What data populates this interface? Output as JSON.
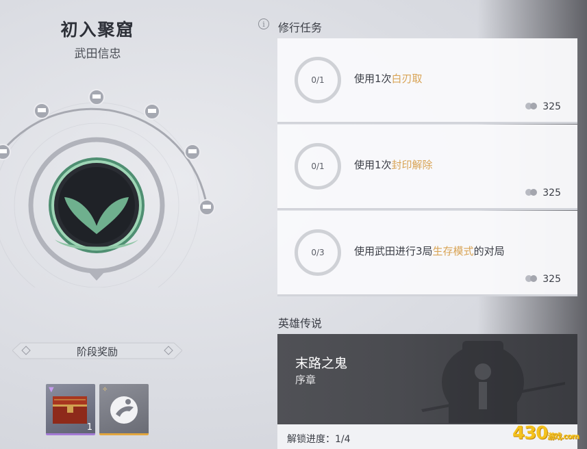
{
  "rank": {
    "title": "初入聚窟",
    "subtitle": "武田信忠"
  },
  "stage_reward": {
    "label": "阶段奖励",
    "items": [
      {
        "name": "treasure-chest",
        "count": "1",
        "rarity_color": "#a37ad4"
      },
      {
        "name": "emote-gesture",
        "count": "",
        "rarity_color": "#e2a63e"
      }
    ]
  },
  "tasks": {
    "title": "修行任务",
    "info_icon": "i",
    "items": [
      {
        "progress": "0/1",
        "prefix": "使用1次",
        "highlight": "白刃取",
        "suffix": "",
        "reward": "325"
      },
      {
        "progress": "0/1",
        "prefix": "使用1次",
        "highlight": "封印解除",
        "suffix": "",
        "reward": "325"
      },
      {
        "progress": "0/3",
        "prefix": "使用武田进行3局",
        "highlight": "生存模式",
        "suffix": "的对局",
        "reward": "325"
      }
    ]
  },
  "legend": {
    "title": "英雄传说",
    "name": "末路之鬼",
    "chapter": "序章",
    "unlock_progress": "解锁进度：1/4"
  },
  "watermark": {
    "main": "430",
    "sub": "游戏",
    "domain": ".com"
  },
  "colors": {
    "highlight": "#d8a354",
    "emblem_green": "#6fb08e",
    "emblem_dark": "#2a2d33"
  }
}
